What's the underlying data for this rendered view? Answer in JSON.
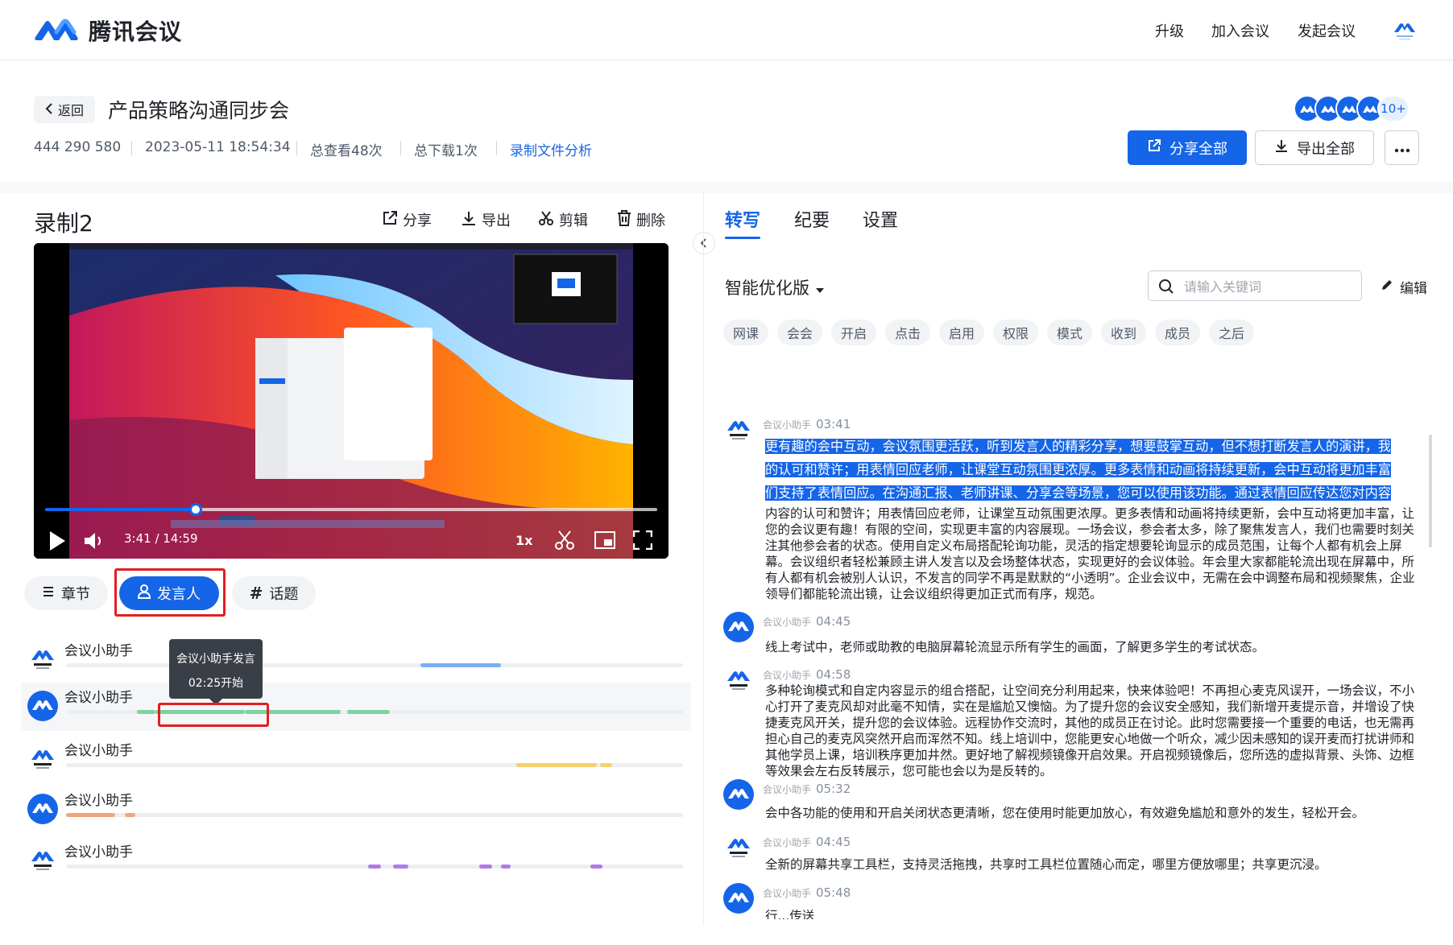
{
  "app": {
    "name": "腾讯会议"
  },
  "nav": {
    "upgrade": "升级",
    "join": "加入会议",
    "start": "发起会议"
  },
  "header": {
    "back_label": "返回",
    "title": "产品策略沟通同步会",
    "meeting_id": "444 290 580",
    "datetime": "2023-05-11 18:54:34",
    "views": "总查看48次",
    "downloads": "总下载1次",
    "analysis_link": "录制文件分析",
    "avatar_more": "10+",
    "share_all": "分享全部",
    "export_all": "导出全部"
  },
  "recording": {
    "title": "录制2",
    "tools": {
      "share": "分享",
      "export": "导出",
      "edit": "剪辑",
      "delete": "删除"
    },
    "player": {
      "time_current": "3:41",
      "time_total": "14:59",
      "speed": "1x",
      "progress": 0.246
    }
  },
  "tabs": {
    "chapters": "章节",
    "speakers": "发言人",
    "topics": "话题"
  },
  "speakers": [
    {
      "name": "会议小助手",
      "color": "#7aaef2",
      "segments": [
        [
          0.575,
          0.705
        ]
      ]
    },
    {
      "name": "会议小助手",
      "color": "#7dd3a0",
      "segments": [
        [
          0.115,
          0.145
        ],
        [
          0.145,
          0.29
        ],
        [
          0.29,
          0.445
        ],
        [
          0.455,
          0.525
        ]
      ]
    },
    {
      "name": "会议小助手",
      "color": "#f5d06b",
      "segments": [
        [
          0.73,
          0.86
        ],
        [
          0.865,
          0.885
        ]
      ]
    },
    {
      "name": "会议小助手",
      "color": "#f2a47a",
      "segments": [
        [
          0.0,
          0.08
        ],
        [
          0.095,
          0.112
        ]
      ]
    },
    {
      "name": "会议小助手",
      "color": "#b07ae8",
      "segments": [
        [
          0.49,
          0.51
        ],
        [
          0.53,
          0.555
        ],
        [
          0.67,
          0.69
        ],
        [
          0.705,
          0.72
        ],
        [
          0.85,
          0.87
        ]
      ]
    }
  ],
  "tooltip": {
    "line1": "会议小助手发言",
    "line2": "02:25开始"
  },
  "right_tabs": {
    "transcript": "转写",
    "minutes": "纪要",
    "settings": "设置"
  },
  "transcript_panel": {
    "version": "智能优化版",
    "search_placeholder": "请输入关键词",
    "edit": "编辑",
    "keywords": [
      "网课",
      "会会",
      "开启",
      "点击",
      "启用",
      "权限",
      "模式",
      "收到",
      "成员",
      "之后"
    ]
  },
  "transcript": [
    {
      "speaker": "会议小助手",
      "time": "03:41",
      "selected": [
        "更有趣的会中互动，会议氛围更活跃，听到发言人的精彩分享，想要鼓掌互动，但不想打断发言人的演讲，我",
        "的认可和赞许；用表情回应老师，让课堂互动氛围更浓厚。更多表情和动画将持续更新，会中互动将更加丰富",
        "们支持了表情回应。在沟通汇报、老师讲课、分享会等场景，您可以使用该功能。通过表情回应传达您对内容"
      ],
      "text": "内容的认可和赞许；用表情回应老师，让课堂互动氛围更浓厚。更多表情和动画将持续更新，会中互动将更加丰富，让您的会议更有趣！有限的空间，实现更丰富的内容展现。一场会议，参会者太多，除了聚焦发言人，我们也需要时刻关注其他参会者的状态。使用自定义布局搭配轮询功能，灵活的指定想要轮询显示的成员范围，让每个人都有机会上屏幕。会议组织者轻松兼顾主讲人发言以及会场整体状态，实现更好的会议体验。年会里大家都能轮流出现在屏幕中，所有人都有机会被别人认识，不发言的同学不再是默默的“小透明”。企业会议中，无需在会中调整布局和视频聚焦，企业领导们都能轮流出镜，让会议组织得更加正式而有序，规范。"
    },
    {
      "speaker": "会议小助手",
      "time": "04:45",
      "text": "线上考试中，老师或助教的电脑屏幕轮流显示所有学生的画面，了解更多学生的考试状态。"
    },
    {
      "speaker": "会议小助手",
      "time": "04:58",
      "text": "多种轮询模式和自定内容显示的组合搭配，让空间充分利用起来，快来体验吧！不再担心麦克风误开，一场会议，不小心打开了麦克风却对此毫不知情，实在是尴尬又懊恼。为了提升您的会议安全感知，我们新增开麦提示音，并增设了快捷麦克风开关，提升您的会议体验。远程协作交流时，其他的成员正在讨论。此时您需要接一个重要的电话，也无需再担心自己的麦克风突然开启而浑然不知。线上培训中，您能更安心地做一个听众，减少因未感知的误开麦而打扰讲师和其他学员上课，培训秩序更加井然。更好地了解视频镜像开启效果。开启视频镜像后，您所选的虚拟背景、头饰、边框等效果会左右反转展示，您可能也会以为是反转的。"
    },
    {
      "speaker": "会议小助手",
      "time": "05:32",
      "text": "会中各功能的使用和开启关闭状态更清晰，您在使用时能更加放心，有效避免尴尬和意外的发生，轻松开会。"
    },
    {
      "speaker": "会议小助手",
      "time": "04:45",
      "text": "全新的屏幕共享工具栏，支持灵活拖拽，共享时工具栏位置随心而定，哪里方便放哪里；共享更沉浸。"
    },
    {
      "speaker": "会议小助手",
      "time": "05:48",
      "text": "行...传送"
    }
  ],
  "colors": {
    "accent": "#1565e8",
    "highlight_box": "#e02020"
  }
}
